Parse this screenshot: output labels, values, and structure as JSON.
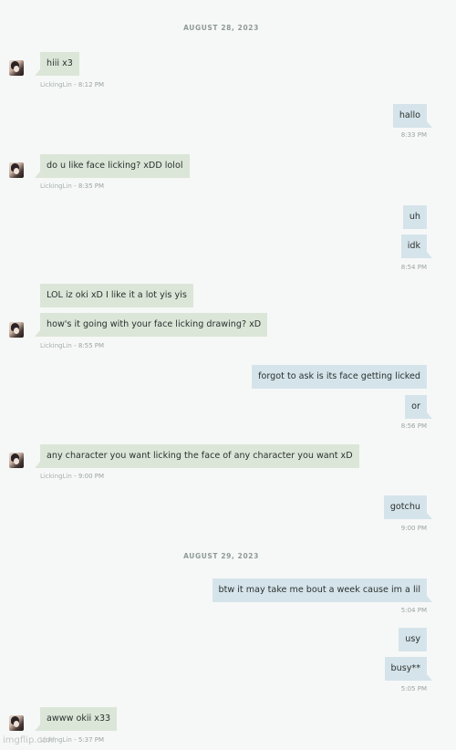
{
  "dates": [
    "AUGUST 28, 2023",
    "AUGUST 29, 2023"
  ],
  "sender_name": "LickingLin",
  "messages": [
    {
      "text": "hiii x3"
    },
    {
      "text": "hallo"
    },
    {
      "text": "do u like face licking? xDD lolol"
    },
    {
      "text": "uh"
    },
    {
      "text": "idk"
    },
    {
      "text": "LOL iz oki xD I like it a lot yis yis"
    },
    {
      "text": "how's it going with your face licking drawing? xD"
    },
    {
      "text": "forgot to ask is its face getting licked"
    },
    {
      "text": "or"
    },
    {
      "text": "any character you want licking the face of any character you want xD"
    },
    {
      "text": "gotchu"
    },
    {
      "text": "btw it may take me bout a week cause im a lil"
    },
    {
      "text": "usy"
    },
    {
      "text": "busy**"
    },
    {
      "text": "awww okii x33"
    }
  ],
  "timestamps": [
    "- 8:12 PM",
    "8:33 PM",
    "- 8:35 PM",
    "8:54 PM",
    "- 8:55 PM",
    "8:56 PM",
    "- 9:00 PM",
    "9:00 PM",
    "5:04 PM",
    "5:05 PM",
    "- 5:37 PM"
  ],
  "watermark": "imgflip.com"
}
